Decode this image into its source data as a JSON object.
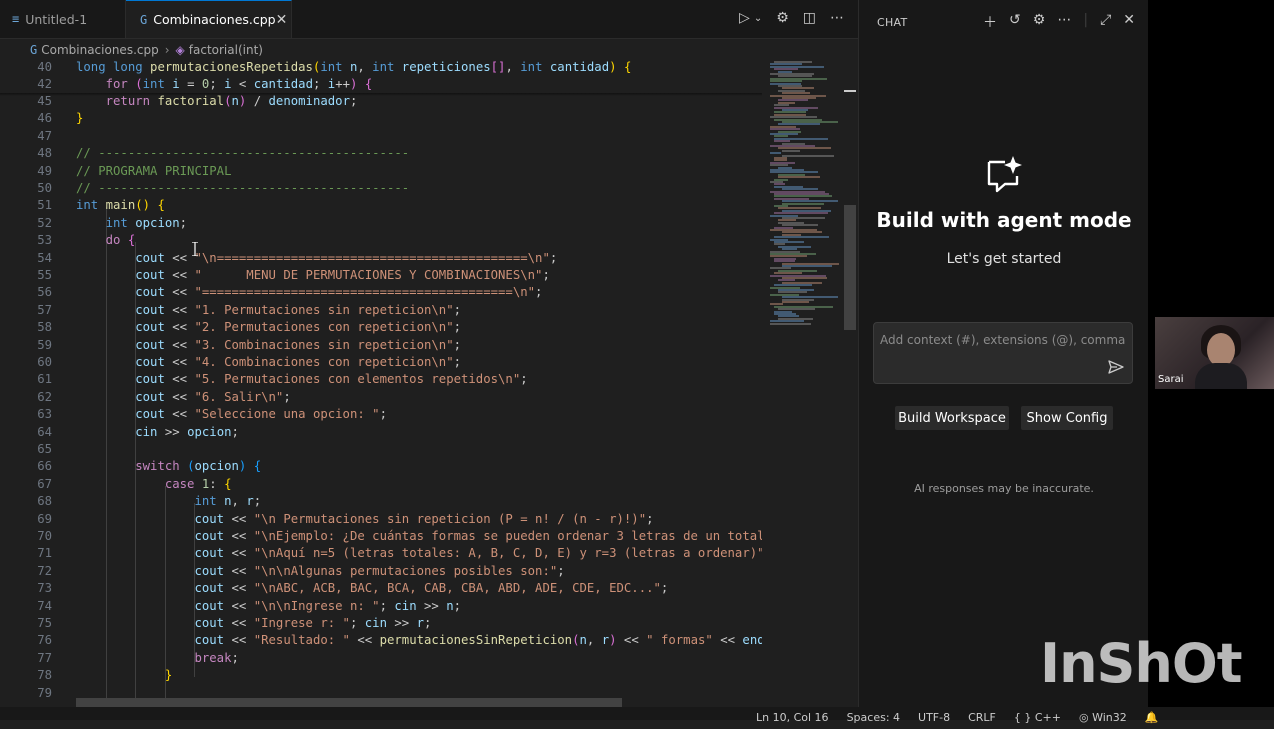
{
  "tabs": [
    {
      "label": "Untitled-1",
      "active": false
    },
    {
      "label": "Combinaciones.cpp",
      "active": true
    }
  ],
  "breadcrumb": {
    "file": "Combinaciones.cpp",
    "symbol": "factorial(int)"
  },
  "sticky": [
    {
      "num": "40",
      "html": "<span class=\"kw\">long long</span> <span class=\"fn\">permutacionesRepetidas</span><span class=\"br1\">(</span><span class=\"kw\">int</span> <span class=\"var\">n</span>, <span class=\"kw\">int</span> <span class=\"var\">repeticiones</span><span class=\"br2\">[]</span>, <span class=\"kw\">int</span> <span class=\"var\">cantidad</span><span class=\"br1\">)</span> <span class=\"br1\">{</span>"
    },
    {
      "num": "42",
      "html": "    <span class=\"ctl\">for</span> <span class=\"br2\">(</span><span class=\"kw\">int</span> <span class=\"var\">i</span> = <span class=\"num\">0</span>; <span class=\"var\">i</span> &lt; <span class=\"var\">cantidad</span>; <span class=\"var\">i</span>++<span class=\"br2\">)</span> <span class=\"br2\">{</span>"
    }
  ],
  "lines": [
    {
      "num": "45",
      "html": "    <span class=\"ctl\">return</span> <span class=\"fn\">factorial</span><span class=\"br2\">(</span><span class=\"var\">n</span><span class=\"br2\">)</span> / <span class=\"var\">denominador</span>;"
    },
    {
      "num": "46",
      "html": "<span class=\"br1\">}</span>"
    },
    {
      "num": "47",
      "html": ""
    },
    {
      "num": "48",
      "html": "<span class=\"cm\">// ------------------------------------------</span>"
    },
    {
      "num": "49",
      "html": "<span class=\"cm\">// PROGRAMA PRINCIPAL</span>"
    },
    {
      "num": "50",
      "html": "<span class=\"cm\">// ------------------------------------------</span>"
    },
    {
      "num": "51",
      "html": "<span class=\"kw\">int</span> <span class=\"fn\">main</span><span class=\"br1\">()</span> <span class=\"br1\">{</span>"
    },
    {
      "num": "52",
      "html": "    <span class=\"kw\">int</span> <span class=\"var\">opcion</span>;"
    },
    {
      "num": "53",
      "html": "    <span class=\"ctl\">do</span> <span class=\"br2\">{</span>"
    },
    {
      "num": "54",
      "html": "        <span class=\"var\">cout</span> &lt;&lt; <span class=\"str\">\"\\n==========================================\\n\"</span>;"
    },
    {
      "num": "55",
      "html": "        <span class=\"var\">cout</span> &lt;&lt; <span class=\"str\">\"      MENU DE PERMUTACIONES Y COMBINACIONES\\n\"</span>;"
    },
    {
      "num": "56",
      "html": "        <span class=\"var\">cout</span> &lt;&lt; <span class=\"str\">\"==========================================\\n\"</span>;"
    },
    {
      "num": "57",
      "html": "        <span class=\"var\">cout</span> &lt;&lt; <span class=\"str\">\"1. Permutaciones sin repeticion\\n\"</span>;"
    },
    {
      "num": "58",
      "html": "        <span class=\"var\">cout</span> &lt;&lt; <span class=\"str\">\"2. Permutaciones con repeticion\\n\"</span>;"
    },
    {
      "num": "59",
      "html": "        <span class=\"var\">cout</span> &lt;&lt; <span class=\"str\">\"3. Combinaciones sin repeticion\\n\"</span>;"
    },
    {
      "num": "60",
      "html": "        <span class=\"var\">cout</span> &lt;&lt; <span class=\"str\">\"4. Combinaciones con repeticion\\n\"</span>;"
    },
    {
      "num": "61",
      "html": "        <span class=\"var\">cout</span> &lt;&lt; <span class=\"str\">\"5. Permutaciones con elementos repetidos\\n\"</span>;"
    },
    {
      "num": "62",
      "html": "        <span class=\"var\">cout</span> &lt;&lt; <span class=\"str\">\"6. Salir\\n\"</span>;"
    },
    {
      "num": "63",
      "html": "        <span class=\"var\">cout</span> &lt;&lt; <span class=\"str\">\"Seleccione una opcion: \"</span>;"
    },
    {
      "num": "64",
      "html": "        <span class=\"var\">cin</span> &gt;&gt; <span class=\"var\">opcion</span>;"
    },
    {
      "num": "65",
      "html": ""
    },
    {
      "num": "66",
      "html": "        <span class=\"ctl\">switch</span> <span class=\"br3\">(</span><span class=\"var\">opcion</span><span class=\"br3\">)</span> <span class=\"br3\">{</span>"
    },
    {
      "num": "67",
      "html": "            <span class=\"ctl\">case</span> <span class=\"num\">1</span>: <span class=\"br1\">{</span>"
    },
    {
      "num": "68",
      "html": "                <span class=\"kw\">int</span> <span class=\"var\">n</span>, <span class=\"var\">r</span>;"
    },
    {
      "num": "69",
      "html": "                <span class=\"var\">cout</span> &lt;&lt; <span class=\"str\">\"\\n Permutaciones sin repeticion (P = n! / (n - r)!)\"</span>;"
    },
    {
      "num": "70",
      "html": "                <span class=\"var\">cout</span> &lt;&lt; <span class=\"str\">\"\\nEjemplo: ¿De cuántas formas se pueden ordenar 3 letras de un total</span>"
    },
    {
      "num": "71",
      "html": "                <span class=\"var\">cout</span> &lt;&lt; <span class=\"str\">\"\\nAquí n=5 (letras totales: A, B, C, D, E) y r=3 (letras a ordenar)\"</span>"
    },
    {
      "num": "72",
      "html": "                <span class=\"var\">cout</span> &lt;&lt; <span class=\"str\">\"\\n\\nAlgunas permutaciones posibles son:\"</span>;"
    },
    {
      "num": "73",
      "html": "                <span class=\"var\">cout</span> &lt;&lt; <span class=\"str\">\"\\nABC, ACB, BAC, BCA, CAB, CBA, ABD, ADE, CDE, EDC...\"</span>;"
    },
    {
      "num": "74",
      "html": "                <span class=\"var\">cout</span> &lt;&lt; <span class=\"str\">\"\\n\\nIngrese n: \"</span>; <span class=\"var\">cin</span> &gt;&gt; <span class=\"var\">n</span>;"
    },
    {
      "num": "75",
      "html": "                <span class=\"var\">cout</span> &lt;&lt; <span class=\"str\">\"Ingrese r: \"</span>; <span class=\"var\">cin</span> &gt;&gt; <span class=\"var\">r</span>;"
    },
    {
      "num": "76",
      "html": "                <span class=\"var\">cout</span> &lt;&lt; <span class=\"str\">\"Resultado: \"</span> &lt;&lt; <span class=\"fn\">permutacionesSinRepeticion</span><span class=\"br2\">(</span><span class=\"var\">n</span>, <span class=\"var\">r</span><span class=\"br2\">)</span> &lt;&lt; <span class=\"str\">\" formas\"</span> &lt;&lt; <span class=\"var\">end</span>"
    },
    {
      "num": "77",
      "html": "                <span class=\"ctl\">break</span>;"
    },
    {
      "num": "78",
      "html": "            <span class=\"br1\">}</span>"
    },
    {
      "num": "79",
      "html": ""
    }
  ],
  "chat": {
    "title": "CHAT",
    "heading": "Build with agent mode",
    "subheading": "Let's get started",
    "placeholder": "Add context (#), extensions (@), commands (/",
    "buttons": [
      "Build Workspace",
      "Show Config"
    ],
    "note": "AI responses may be inaccurate."
  },
  "status": {
    "position": "Ln 10, Col 16",
    "spaces": "Spaces: 4",
    "encoding": "UTF-8",
    "eol": "CRLF",
    "language": "C++",
    "platform": "Win32"
  },
  "webcam_name": "Sarai",
  "watermark": "InShOt"
}
